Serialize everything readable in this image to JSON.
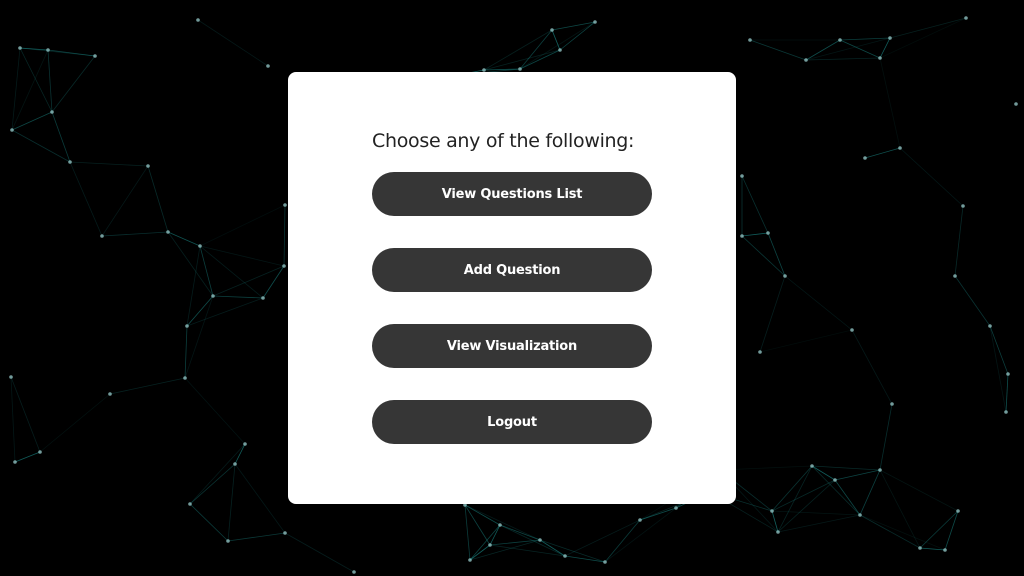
{
  "background": {
    "color": "#000000",
    "line_color": "#1fa3a0",
    "node_color": "#8fbfbf"
  },
  "card": {
    "heading": "Choose any of the following:",
    "background": "#ffffff"
  },
  "menu": {
    "button_color": "#363636",
    "items": [
      {
        "label": "View Questions List"
      },
      {
        "label": "Add Question"
      },
      {
        "label": "View Visualization"
      },
      {
        "label": "Logout"
      }
    ]
  }
}
